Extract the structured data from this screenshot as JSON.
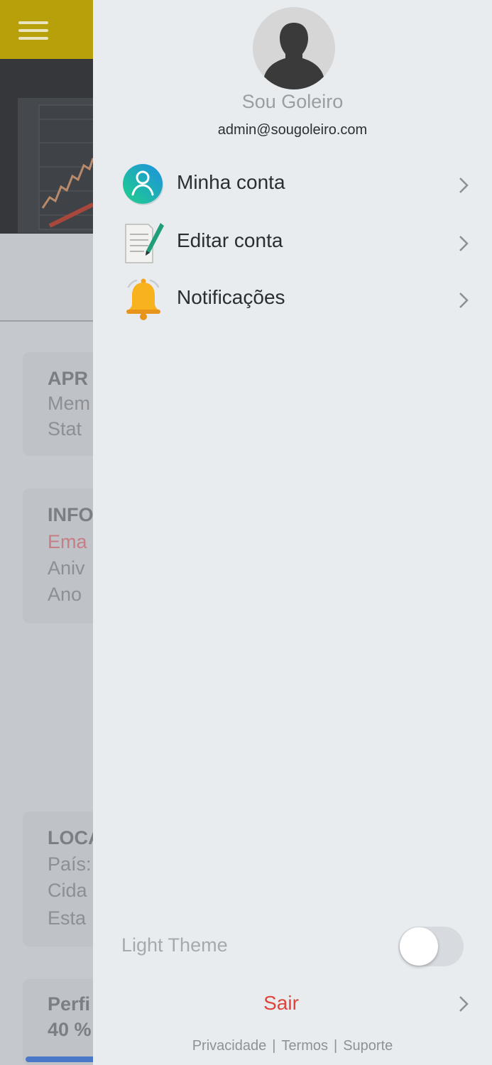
{
  "colors": {
    "appbar": "#b8a00a",
    "drawer_bg": "#e9ecef",
    "logout": "#e0453b",
    "accent_blue": "#4a78c8"
  },
  "background": {
    "cards": [
      {
        "lines": [
          "APR",
          "Mem",
          "Stat"
        ]
      },
      {
        "lines": [
          "INFO",
          "Ema",
          "Aniv",
          "Ano"
        ]
      },
      {
        "lines": [
          "LOCA",
          "País:",
          "Cida",
          "Esta"
        ]
      },
      {
        "lines": [
          "Perfi",
          "40 %"
        ]
      }
    ]
  },
  "drawer": {
    "user": {
      "name": "Sou Goleiro",
      "email": "admin@sougoleiro.com",
      "avatar_icon": "user-silhouette-icon"
    },
    "menu": [
      {
        "label": "Minha conta",
        "icon": "user-circle-icon"
      },
      {
        "label": "Editar conta",
        "icon": "edit-document-icon"
      },
      {
        "label": "Notificações",
        "icon": "bell-icon"
      }
    ],
    "theme": {
      "label": "Light Theme",
      "enabled": false
    },
    "logout_label": "Sair",
    "footer": {
      "privacy": "Privacidade",
      "terms": "Termos",
      "support": "Suporte",
      "separator": "|"
    }
  }
}
